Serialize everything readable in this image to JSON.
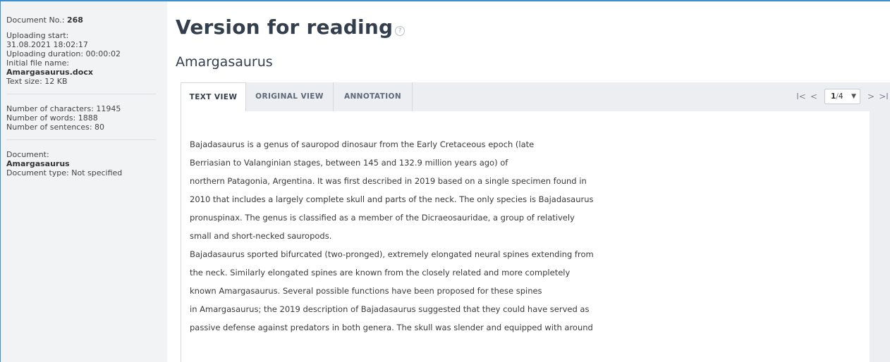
{
  "sidebar": {
    "document_no_label": "Document No.: ",
    "document_no": "268",
    "upload_start_label": "Uploading start:",
    "upload_start_value": "31.08.2021 18:02:17",
    "upload_duration": "Uploading duration: 00:00:02",
    "initial_file_label": "Initial file name:",
    "initial_file_name": "Amargasaurus.docx",
    "text_size": "Text size: 12 KB",
    "chars": "Number of characters: 11945",
    "words": "Number of words: 1888",
    "sentences": "Number of sentences: 80",
    "document_label": "Document:",
    "document_name": "Amargasaurus",
    "document_type": "Document type: Not specified"
  },
  "header": {
    "title": "Version for reading",
    "help_glyph": "?",
    "doc_name": "Amargasaurus"
  },
  "tabs": [
    {
      "label": "TEXT VIEW",
      "active": true
    },
    {
      "label": "ORIGINAL VIEW",
      "active": false
    },
    {
      "label": "ANNOTATION",
      "active": false
    }
  ],
  "pager": {
    "first": "I<",
    "prev": "<",
    "current": "1",
    "sep": "/",
    "total": "4",
    "next": ">",
    "last": ">I"
  },
  "content": {
    "lines": [
      "Bajadasaurus is a genus of sauropod dinosaur from the Early Cretaceous epoch (late",
      "Berriasian to Valanginian stages, between 145 and 132.9 million years ago) of",
      "northern Patagonia, Argentina. It was first described in 2019 based on a single specimen found in",
      "2010 that includes a largely complete skull and parts of the neck. The only species is Bajadasaurus",
      "pronuspinax. The genus is classified as a member of the Dicraeosauridae, a group of relatively",
      "small and short-necked sauropods.",
      "Bajadasaurus sported bifurcated (two-pronged), extremely elongated neural spines extending from",
      "the neck. Similarly elongated spines are known from the closely related and more completely",
      "known Amargasaurus. Several possible functions have been proposed for these spines",
      "in Amargasaurus; the 2019 description of Bajadasaurus suggested that they could have served as",
      "passive defense against predators in both genera. The skull was slender and equipped with around"
    ]
  },
  "colors": {
    "accent_border": "#3d8fd4",
    "sidebar_bg": "#f2f3f5",
    "title": "#333e4f"
  }
}
